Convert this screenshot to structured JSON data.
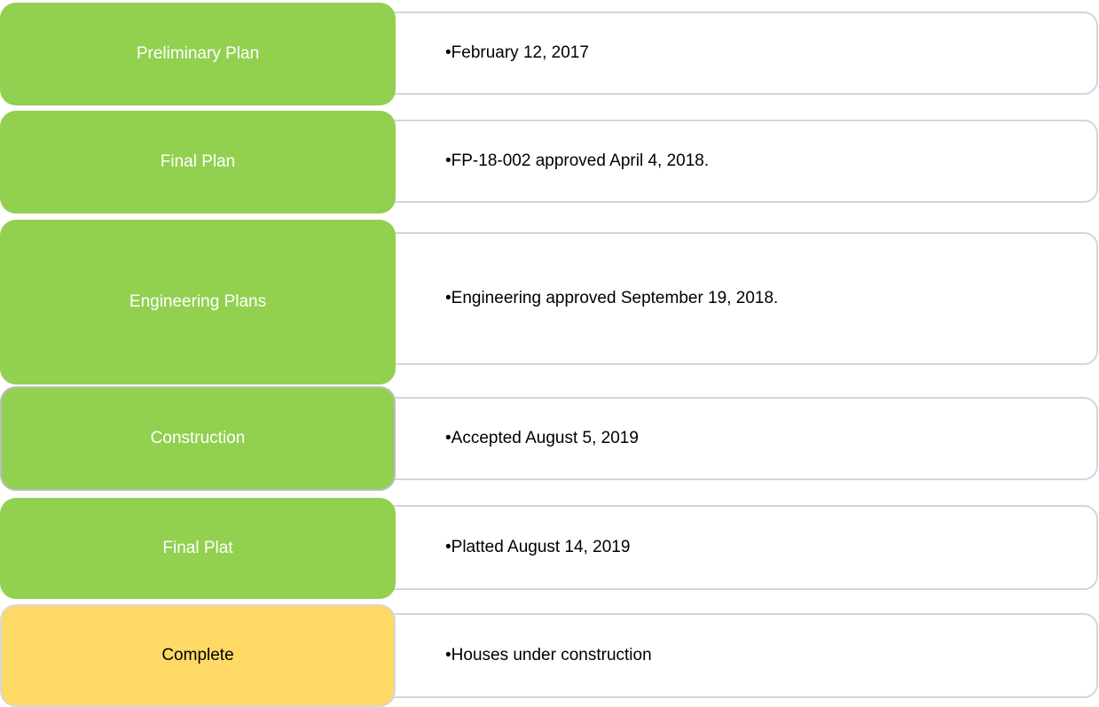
{
  "colors": {
    "completed_stage": "#92d050",
    "current_stage": "#ffd966",
    "detail_border": "#d2d6da"
  },
  "stages": [
    {
      "label": "Preliminary Plan",
      "detail": "•February 12, 2017",
      "status": "completed"
    },
    {
      "label": "Final Plan",
      "detail": "•FP-18-002 approved April 4, 2018.",
      "status": "completed"
    },
    {
      "label": "Engineering Plans",
      "detail": "•Engineering approved September 19, 2018.",
      "status": "completed"
    },
    {
      "label": "Construction",
      "detail": "•Accepted August 5, 2019",
      "status": "completed"
    },
    {
      "label": "Final Plat",
      "detail": "•Platted August 14, 2019",
      "status": "completed"
    },
    {
      "label": "Complete",
      "detail": "•Houses under construction",
      "status": "current"
    }
  ]
}
